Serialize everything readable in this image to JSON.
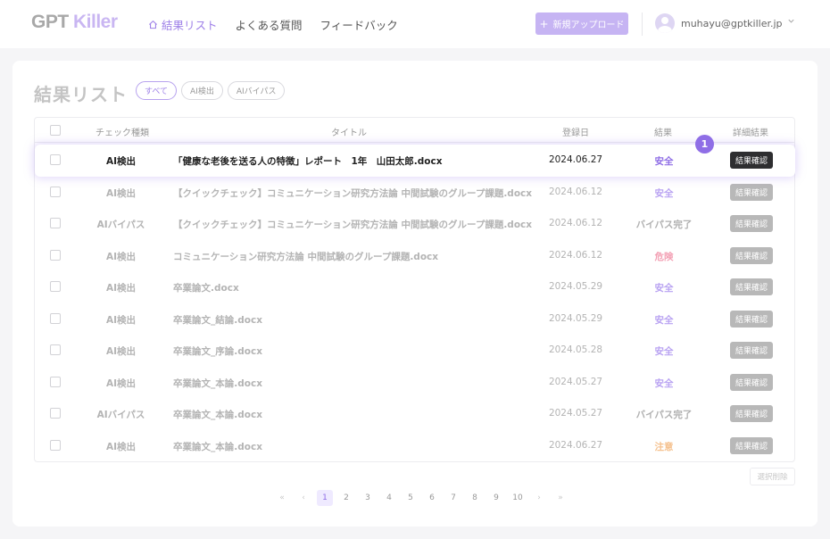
{
  "header": {
    "logo_gpt": "GPT",
    "logo_killer": "Killer",
    "nav": [
      "結果リスト",
      "よくある質問",
      "フィードバック"
    ],
    "upload_label": "新規アップロード",
    "user_email": "muhayu@gptkiller.jp"
  },
  "page": {
    "title": "結果リスト",
    "filters": [
      "すべて",
      "AI検出",
      "AIバイパス"
    ],
    "active_filter": "すべて"
  },
  "table": {
    "columns": [
      "チェック種類",
      "タイトル",
      "登録日",
      "結果",
      "詳細結果"
    ],
    "detail_label": "結果確認",
    "rows": [
      {
        "type": "AI検出",
        "title": "「健康な老後を送る人の特徴」レポート　1年　山田太郎.docx",
        "date": "2024.06.27",
        "result": "安全",
        "status": "safe",
        "highlight": true
      },
      {
        "type": "AI検出",
        "title": "【クイックチェック】コミュニケーション研究方法論 中間試験のグループ課題.docx",
        "date": "2024.06.12",
        "result": "安全",
        "status": "safe"
      },
      {
        "type": "AIバイパス",
        "title": "【クイックチェック】コミュニケーション研究方法論 中間試験のグループ課題.docx",
        "date": "2024.06.12",
        "result": "バイパス完了",
        "status": "bypass"
      },
      {
        "type": "AI検出",
        "title": "コミュニケーション研究方法論 中間試験のグループ課題.docx",
        "date": "2024.06.12",
        "result": "危険",
        "status": "danger"
      },
      {
        "type": "AI検出",
        "title": "卒業論文.docx",
        "date": "2024.05.29",
        "result": "安全",
        "status": "safe"
      },
      {
        "type": "AI検出",
        "title": "卒業論文_結論.docx",
        "date": "2024.05.29",
        "result": "安全",
        "status": "safe"
      },
      {
        "type": "AI検出",
        "title": "卒業論文_序論.docx",
        "date": "2024.05.28",
        "result": "安全",
        "status": "safe"
      },
      {
        "type": "AI検出",
        "title": "卒業論文_本論.docx",
        "date": "2024.05.27",
        "result": "安全",
        "status": "safe"
      },
      {
        "type": "AIバイパス",
        "title": "卒業論文_本論.docx",
        "date": "2024.05.27",
        "result": "バイパス完了",
        "status": "bypass"
      },
      {
        "type": "AI検出",
        "title": "卒業論文_本論.docx",
        "date": "2024.06.27",
        "result": "注意",
        "status": "caution"
      }
    ]
  },
  "step_badge": "1",
  "delete_label": "選択削除",
  "pagination": {
    "first": "«",
    "prev": "‹",
    "pages": [
      "1",
      "2",
      "3",
      "4",
      "5",
      "6",
      "7",
      "8",
      "9",
      "10"
    ],
    "current": "1",
    "next": "›",
    "last": "»"
  },
  "colors": {
    "accent": "#8f6ee6",
    "accent_light": "#c6b4f3",
    "danger": "#f3a0b4",
    "caution": "#f5c290",
    "button_dark": "#2e2e30"
  },
  "icons": {
    "nav_home": "home-icon",
    "upload": "plus-icon",
    "user": "avatar",
    "menu": "chevron-down-icon"
  }
}
